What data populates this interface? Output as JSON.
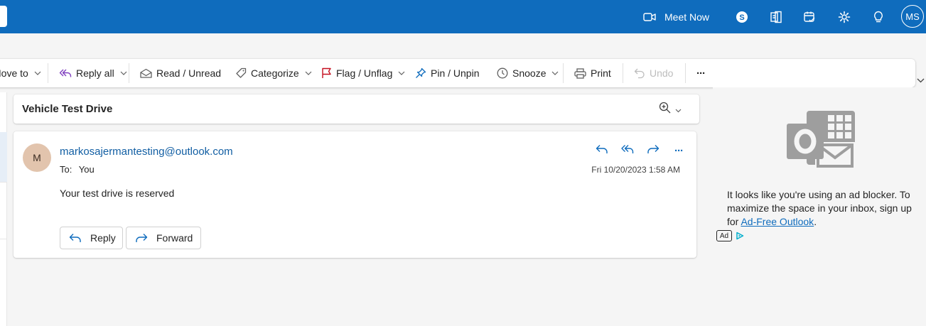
{
  "topbar": {
    "meet_now_label": "Meet Now",
    "avatar_initials": "MS",
    "background": "#0f6cbd"
  },
  "ribbon": {
    "move_to": "Move to",
    "reply_all": "Reply all",
    "read_unread": "Read / Unread",
    "categorize": "Categorize",
    "flag_unflag": "Flag / Unflag",
    "pin_unpin": "Pin / Unpin",
    "snooze": "Snooze",
    "print": "Print",
    "undo": "Undo",
    "more": "···"
  },
  "message": {
    "subject": "Vehicle Test Drive",
    "sender_initial": "M",
    "sender": "markosajermantesting@outlook.com",
    "to_label": "To:",
    "to_value": "You",
    "date": "Fri 10/20/2023 1:58 AM",
    "body": "Your test drive is reserved",
    "reply_button": "Reply",
    "forward_button": "Forward",
    "more": "···"
  },
  "ad": {
    "text_before_link": "It looks like you're using an ad blocker. To maximize the space in your inbox, sign up for ",
    "link_text": "Ad-Free Outlook",
    "text_after_link": ".",
    "badge": "Ad"
  },
  "colors": {
    "brand": "#0f6cbd",
    "link": "#115ea3",
    "flag": "#c50f1f",
    "avatar_bg": "#e2c4ad"
  }
}
